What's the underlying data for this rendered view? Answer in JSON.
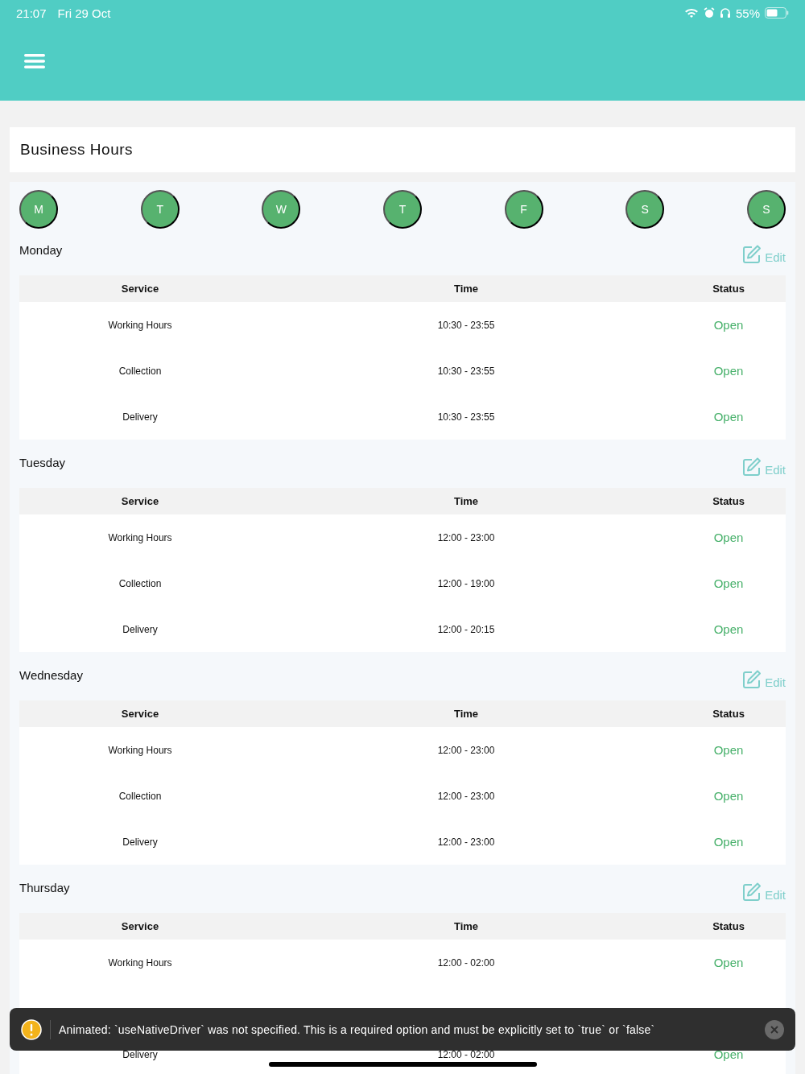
{
  "status_bar": {
    "time": "21:07",
    "date": "Fri 29 Oct",
    "battery_text": "55%"
  },
  "title": "Business Hours",
  "days": [
    "M",
    "T",
    "W",
    "T",
    "F",
    "S",
    "S"
  ],
  "sections": [
    {
      "day": "Monday",
      "edit_label": "Edit",
      "columns": [
        "Service",
        "Time",
        "Status"
      ],
      "rows": [
        {
          "kind": "data",
          "service": "Working Hours",
          "time": "10:30 - 23:55",
          "status": "Open"
        },
        {
          "kind": "data",
          "service": "Collection",
          "time": "10:30 - 23:55",
          "status": "Open"
        },
        {
          "kind": "data",
          "service": "Delivery",
          "time": "10:30 - 23:55",
          "status": "Open"
        }
      ]
    },
    {
      "day": "Tuesday",
      "edit_label": "Edit",
      "columns": [
        "Service",
        "Time",
        "Status"
      ],
      "rows": [
        {
          "kind": "data",
          "service": "Working Hours",
          "time": "12:00 - 23:00",
          "status": "Open"
        },
        {
          "kind": "data",
          "service": "Collection",
          "time": "12:00 - 19:00",
          "status": "Open"
        },
        {
          "kind": "data",
          "service": "Delivery",
          "time": "12:00 - 20:15",
          "status": "Open"
        }
      ]
    },
    {
      "day": "Wednesday",
      "edit_label": "Edit",
      "columns": [
        "Service",
        "Time",
        "Status"
      ],
      "rows": [
        {
          "kind": "data",
          "service": "Working Hours",
          "time": "12:00 - 23:00",
          "status": "Open"
        },
        {
          "kind": "data",
          "service": "Collection",
          "time": "12:00 - 23:00",
          "status": "Open"
        },
        {
          "kind": "data",
          "service": "Delivery",
          "time": "12:00 - 23:00",
          "status": "Open"
        }
      ]
    },
    {
      "day": "Thursday",
      "edit_label": "Edit",
      "columns": [
        "Service",
        "Time",
        "Status"
      ],
      "rows": [
        {
          "kind": "data",
          "service": "Working Hours",
          "time": "12:00 - 02:00",
          "status": "Open"
        },
        {
          "kind": "covered"
        },
        {
          "kind": "data",
          "service": "Delivery",
          "time": "12:00 - 02:00",
          "status": "Open"
        }
      ]
    }
  ],
  "toast": {
    "message": "Animated: `useNativeDriver` was not specified. This is a required option and must be explicitly set to `true` or `false`"
  }
}
